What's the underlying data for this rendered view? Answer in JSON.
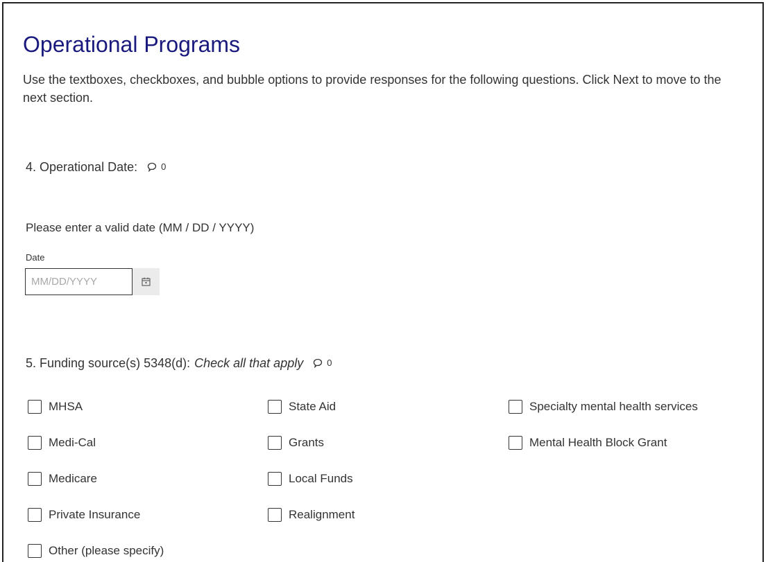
{
  "page": {
    "title": "Operational Programs",
    "intro": "Use the textboxes, checkboxes, and bubble options to provide responses for the following questions. Click Next to move to the next section."
  },
  "q4": {
    "label": "4. Operational Date:",
    "comment_icon": "comment-bubble-icon",
    "comment_count": "0",
    "prompt": "Please enter a valid date (MM / DD / YYYY)",
    "field_label": "Date",
    "placeholder": "MM/DD/YYYY",
    "value": "",
    "calendar_icon": "calendar-icon"
  },
  "q5": {
    "label": "5. Funding source(s) 5348(d):",
    "instruction": "Check all that apply",
    "comment_icon": "comment-bubble-icon",
    "comment_count": "0",
    "options": [
      {
        "label": "MHSA",
        "checked": false
      },
      {
        "label": "Medi-Cal",
        "checked": false
      },
      {
        "label": "Medicare",
        "checked": false
      },
      {
        "label": "Private Insurance",
        "checked": false
      },
      {
        "label": "Other (please specify)",
        "checked": false
      },
      {
        "label": "State Aid",
        "checked": false
      },
      {
        "label": "Grants",
        "checked": false
      },
      {
        "label": "Local Funds",
        "checked": false
      },
      {
        "label": "Realignment",
        "checked": false
      },
      {
        "label": "Specialty mental health services",
        "checked": false
      },
      {
        "label": "Mental Health Block Grant",
        "checked": false
      }
    ]
  },
  "colors": {
    "title": "#1a1a7e",
    "text": "#333333",
    "calendar_button_bg": "#ebebeb"
  }
}
